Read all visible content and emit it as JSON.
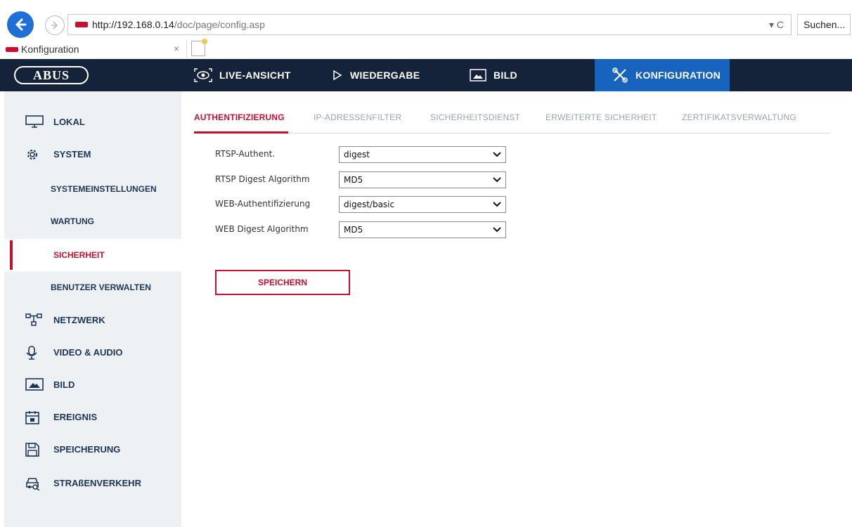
{
  "browser": {
    "url_host": "http://192.168.0.14",
    "url_path": "/doc/page/config.asp",
    "url_controls": "▾ C",
    "search_placeholder": "Suchen...",
    "tab_title": "Konfiguration",
    "tab_close": "×"
  },
  "header": {
    "logo": "ABUS",
    "nav": [
      {
        "label": "LIVE-ANSICHT",
        "icon": "eye-icon"
      },
      {
        "label": "WIEDERGABE",
        "icon": "play-icon"
      },
      {
        "label": "BILD",
        "icon": "image-icon"
      },
      {
        "label": "KONFIGURATION",
        "icon": "tools-icon",
        "active": true
      }
    ],
    "accent": "#1863bd",
    "background": "#14223a"
  },
  "sidebar": {
    "items": [
      {
        "label": "LOKAL",
        "icon": "monitor-icon"
      },
      {
        "label": "SYSTEM",
        "icon": "gear-icon"
      },
      {
        "label": "SYSTEMEINSTELLUNGEN",
        "sub": true
      },
      {
        "label": "WARTUNG",
        "sub": true
      },
      {
        "label": "SICHERHEIT",
        "sub": true,
        "active": true
      },
      {
        "label": "BENUTZER VERWALTEN",
        "sub": true
      },
      {
        "label": "NETZWERK",
        "icon": "network-icon"
      },
      {
        "label": "VIDEO & AUDIO",
        "icon": "microphone-icon"
      },
      {
        "label": "BILD",
        "icon": "image-icon"
      },
      {
        "label": "EREIGNIS",
        "icon": "calendar-icon"
      },
      {
        "label": "SPEICHERUNG",
        "icon": "floppy-icon"
      },
      {
        "label": "STRAßENVERKEHR",
        "icon": "car-search-icon"
      }
    ]
  },
  "content": {
    "tabs": [
      {
        "label": "AUTHENTIFIZIERUNG",
        "active": true
      },
      {
        "label": "IP-ADRESSENFILTER"
      },
      {
        "label": "SICHERHEITSDIENST"
      },
      {
        "label": "ERWEITERTE SICHERHEIT"
      },
      {
        "label": "ZERTIFIKATSVERWALTUNG"
      }
    ],
    "fields": [
      {
        "label": "RTSP-Authent.",
        "value": "digest"
      },
      {
        "label": "RTSP Digest Algorithm",
        "value": "MD5"
      },
      {
        "label": "WEB-Authentifizierung",
        "value": "digest/basic"
      },
      {
        "label": "WEB Digest Algorithm",
        "value": "MD5"
      }
    ],
    "save_label": "SPEICHERN",
    "accent": "#c8102e"
  }
}
